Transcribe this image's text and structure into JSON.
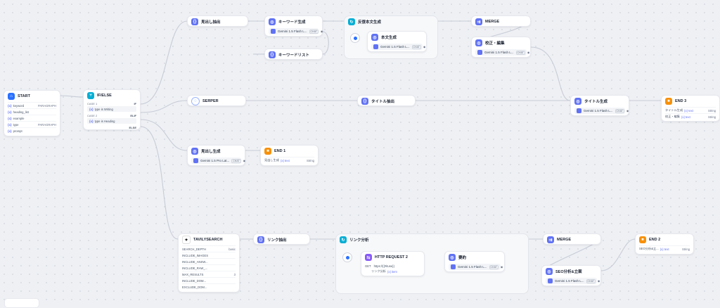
{
  "nodes": {
    "start": {
      "title": "START",
      "vars": [
        {
          "name": "keyword",
          "type": "PARAGRAPH"
        },
        {
          "name": "heading_list",
          "type": ""
        },
        {
          "name": "example",
          "type": ""
        },
        {
          "name": "type",
          "type": "PARAGRAPH"
        },
        {
          "name": "prompt",
          "type": ""
        }
      ]
    },
    "ifelse": {
      "title": "IF/ELSE",
      "case1": "CASE 1",
      "if_label": "IF",
      "cond1_var": "type",
      "cond1_op": "is",
      "cond1_val": "Writing",
      "case2": "CASE 2",
      "elif_label": "ELIF",
      "cond2_var": "type",
      "cond2_op": "is",
      "cond2_val": "Heading",
      "else_label": "ELSE"
    },
    "midashi_chushutsu": {
      "title": "見出し抽出"
    },
    "keyword_gen": {
      "title": "キーワード生成",
      "model": "Gemini 1.5 Flash L...",
      "tag": "CHAT"
    },
    "keyword_list": {
      "title": "キーワードリスト"
    },
    "iter_honbun": {
      "title": "反復本文生成"
    },
    "honbun_gen": {
      "title": "本文生成",
      "model": "Gemini 1.5 Flash L...",
      "tag": "CHAT"
    },
    "merge1": {
      "title": "MERGE"
    },
    "kotei": {
      "title": "校正・編集",
      "model": "Gemini 1.5 Flash L...",
      "tag": "CHAT"
    },
    "serper": {
      "title": "SERPER"
    },
    "title_extract": {
      "title": "タイトル抽出"
    },
    "title_gen": {
      "title": "タイトル生成",
      "model": "Gemini 1.5 Flash L...",
      "tag": "CHAT"
    },
    "end3": {
      "title": "END 3",
      "rows": [
        {
          "label": "タイトル生成",
          "tok": "{x} text",
          "type": "String"
        },
        {
          "label": "校正・編集",
          "tok": "{x} text",
          "type": "String"
        }
      ]
    },
    "midashi_gen": {
      "title": "見出し生成",
      "model": "Gemini 1.5 Pro Lat...",
      "tag": "CHAT"
    },
    "end1": {
      "title": "END 1",
      "rows": [
        {
          "label": "見出し生成",
          "tok": "{x} text",
          "type": "String"
        }
      ]
    },
    "tavily": {
      "title": "TAVILYSEARCH",
      "params": [
        {
          "name": "SEARCH_DEPTH",
          "val": "basic"
        },
        {
          "name": "INCLUDE_IMAGES",
          "val": ""
        },
        {
          "name": "INCLUDE_ANSW...",
          "val": ""
        },
        {
          "name": "INCLUDE_RAW_...",
          "val": ""
        },
        {
          "name": "MAX_RESULTS",
          "val": "3"
        },
        {
          "name": "INCLUDE_DOM...",
          "val": ""
        },
        {
          "name": "EXCLUDE_DOM...",
          "val": ""
        }
      ]
    },
    "link_extract": {
      "title": "リンク抽出"
    },
    "link_analysis": {
      "title": "リンク分析"
    },
    "http2": {
      "title": "HTTP REQUEST 2",
      "method": "GET",
      "url": "https://{{#ituse}}",
      "sub_label": "リンク分析",
      "sub_tok": "{x} item"
    },
    "yoyaku": {
      "title": "要約",
      "model": "Gemini 1.5 Flash L...",
      "tag": "CHAT"
    },
    "merge2": {
      "title": "MERGE"
    },
    "seo": {
      "title": "SEO分析&立案",
      "model": "Gemini 1.5 Flash L...",
      "tag": "CHAT"
    },
    "end2": {
      "title": "END 2",
      "rows": [
        {
          "label": "SEO分析&立...",
          "tok": "{x} text",
          "type": "String"
        }
      ]
    }
  }
}
